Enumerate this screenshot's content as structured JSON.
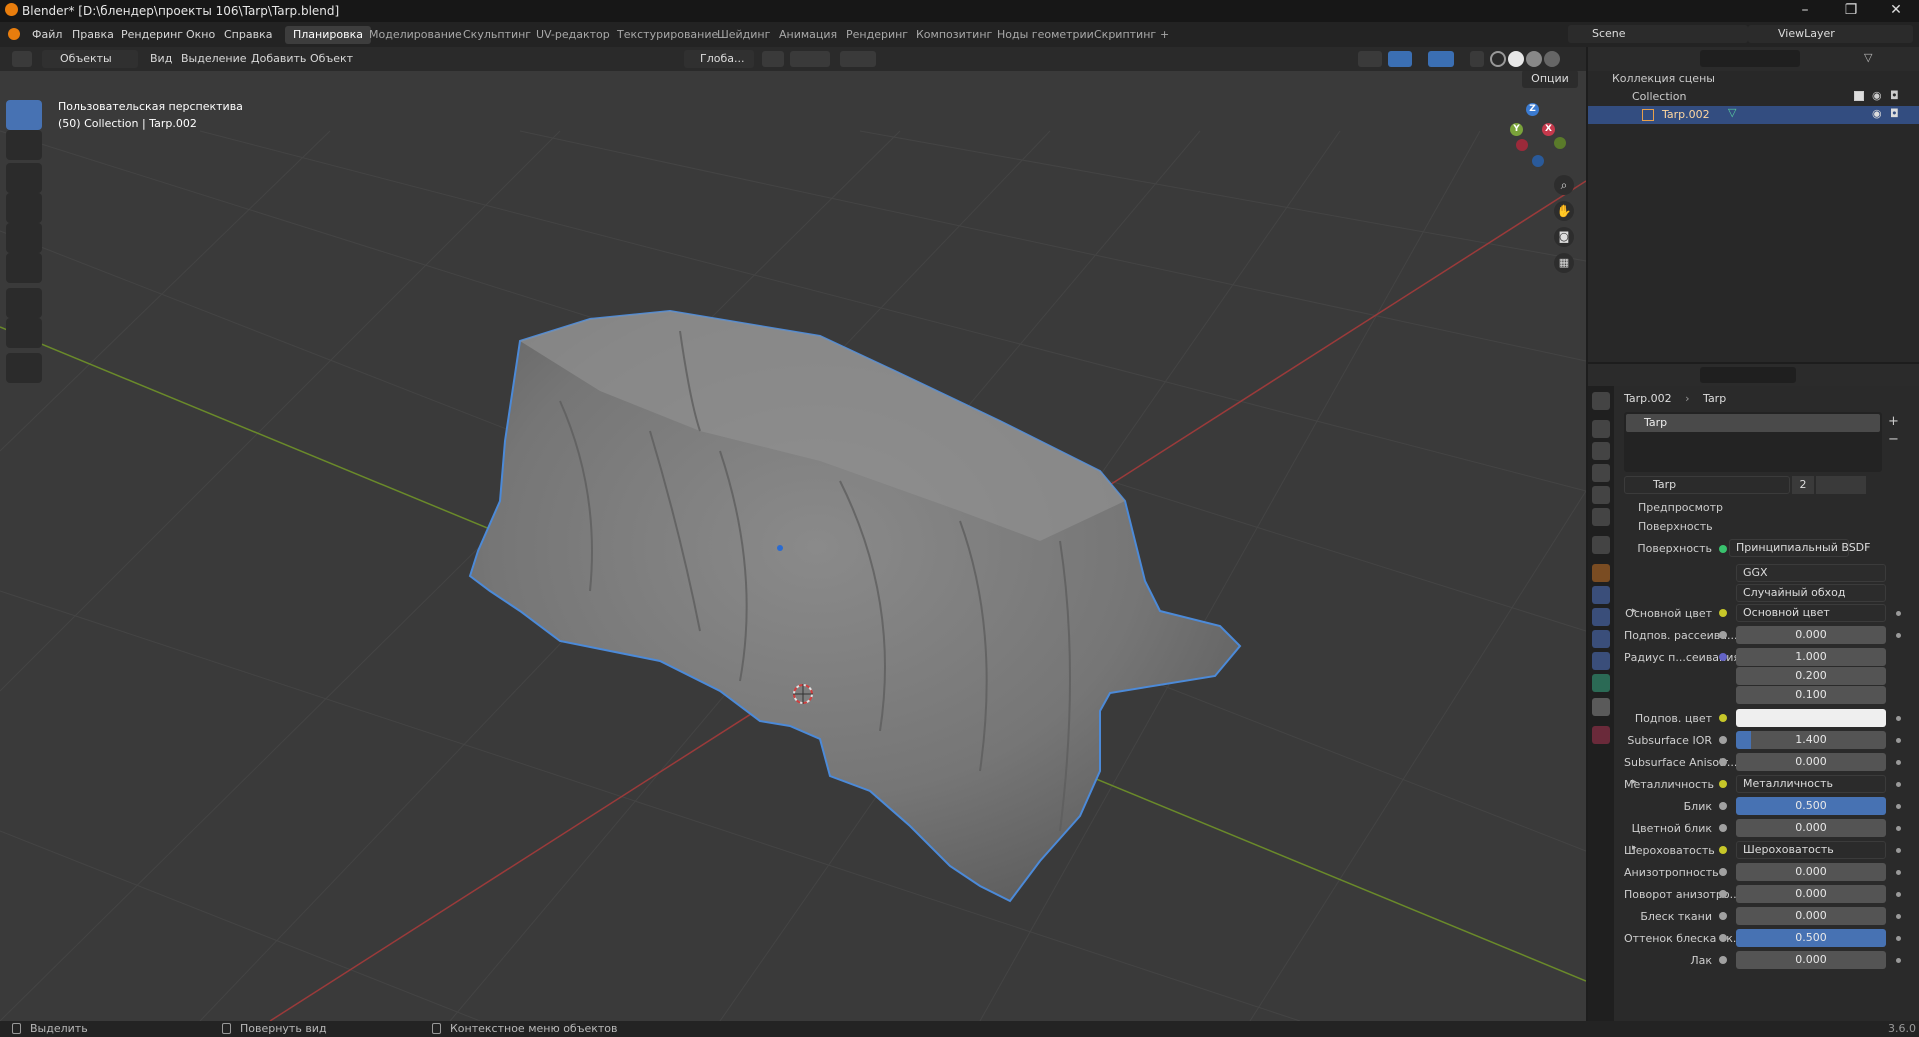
{
  "window": {
    "title": "Blender* [D:\\блендер\\проекты 106\\Tarp\\Tarp.blend]"
  },
  "menu": [
    "Файл",
    "Правка",
    "Рендеринг",
    "Окно",
    "Справка"
  ],
  "workspaces": [
    "Планировка",
    "Моделирование",
    "Скульптинг",
    "UV-редактор",
    "Текстурирование",
    "Шейдинг",
    "Анимация",
    "Рендеринг",
    "Композитинг",
    "Ноды геометрии",
    "Скриптинг"
  ],
  "workspace_active": "Планировка",
  "workspace_add": "+",
  "scene": "Scene",
  "view_layer": "ViewLayer",
  "viewport": {
    "mode": "Объекты",
    "menus": [
      "Вид",
      "Выделение",
      "Добавить",
      "Объект"
    ],
    "transform_orientation": "Глоба...",
    "options": "Опции",
    "info_line1": "Пользовательская перспектива",
    "info_line2": "(50) Collection | Tarp.002",
    "gizmo": {
      "x": "X",
      "y": "Y",
      "z": "Z"
    }
  },
  "outliner": {
    "scene_collection": "Коллекция сцены",
    "collection": "Collection",
    "object": "Tarp.002"
  },
  "properties": {
    "breadcrumb": {
      "object": "Tarp.002",
      "material": "Tarp"
    },
    "material_slot": "Tarp",
    "material_name": "Tarp",
    "users": "2",
    "preview_section": "Предпросмотр",
    "surface_section": "Поверхность",
    "surface_label": "Поверхность",
    "surface_shader": "Принципиальный BSDF",
    "distribution": "GGX",
    "subsurface_method": "Случайный обход",
    "rows": [
      {
        "label": "Основной цвет",
        "link": "Основной цвет",
        "expand": true
      },
      {
        "label": "Подпов. рассеива...",
        "value": "0.000",
        "fill": 0
      },
      {
        "label": "Радиус п...сеивания",
        "vector": [
          "1.000",
          "0.200",
          "0.100"
        ]
      },
      {
        "label": "Подпов. цвет",
        "color": "#efefef"
      },
      {
        "label": "Subsurface IOR",
        "value": "1.400",
        "fill": 0.1
      },
      {
        "label": "Subsurface Anisotr...",
        "value": "0.000",
        "fill": 0
      },
      {
        "label": "Металличность",
        "link": "Металличность",
        "expand": true
      },
      {
        "label": "Блик",
        "value": "0.500",
        "fill": 1
      },
      {
        "label": "Цветной блик",
        "value": "0.000",
        "fill": 0
      },
      {
        "label": "Шероховатость",
        "link": "Шероховатость",
        "expand": true
      },
      {
        "label": "Анизотропность",
        "value": "0.000",
        "fill": 0
      },
      {
        "label": "Поворот анизотро...",
        "value": "0.000",
        "fill": 0
      },
      {
        "label": "Блеск ткани",
        "value": "0.000",
        "fill": 0
      },
      {
        "label": "Оттенок блеска тк...",
        "value": "0.500",
        "fill": 1
      },
      {
        "label": "Лак",
        "value": "0.000",
        "fill": 0
      }
    ]
  },
  "statusbar": {
    "select": "Выделить",
    "rotate": "Повернуть вид",
    "context": "Контекстное меню объектов",
    "version": "3.6.0"
  },
  "colors": {
    "accent": "#4772b3",
    "selection_outline": "#4c8ad8",
    "x_axis": "#b8394a",
    "y_axis": "#7aa33a",
    "z_axis": "#3b7bd1",
    "header": "#232323",
    "viewport_bg": "#3a3a3a"
  },
  "icons": [
    "blender-logo-icon",
    "minimize-icon",
    "maximize-icon",
    "close-icon",
    "select-box-icon",
    "cursor-icon",
    "move-icon",
    "rotate-icon",
    "scale-icon",
    "transform-icon",
    "annotate-icon",
    "measure-icon",
    "add-cube-icon",
    "zoom-icon",
    "hand-icon",
    "camera-icon",
    "grid-icon",
    "eye-icon",
    "camera-restrict-icon",
    "checkbox-icon",
    "material-icon",
    "mesh-icon",
    "search-icon",
    "filter-icon"
  ]
}
